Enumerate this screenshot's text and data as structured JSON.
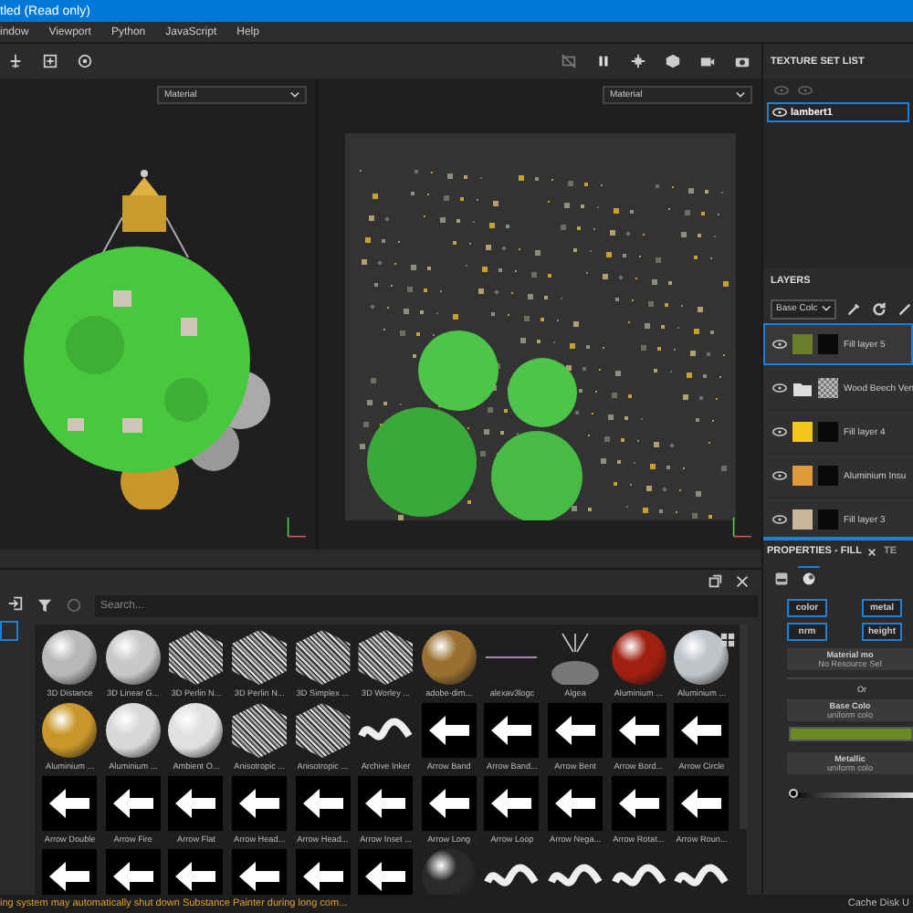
{
  "window": {
    "title": "tled (Read only)"
  },
  "menu": [
    "indow",
    "Viewport",
    "Python",
    "JavaScript",
    "Help"
  ],
  "viewports": [
    {
      "mode": "Material",
      "kind": "model"
    },
    {
      "mode": "Material",
      "kind": "uv"
    }
  ],
  "texture_set_list": {
    "title": "TEXTURE SET LIST",
    "items": [
      {
        "name": "lambert1",
        "selected": true
      }
    ]
  },
  "layers": {
    "title": "LAYERS",
    "channel": "Base Colc",
    "items": [
      {
        "name": "Fill layer 5",
        "kind": "fill",
        "color": "#6b7f2a",
        "selected": true
      },
      {
        "name": "Wood Beech Ven",
        "kind": "folder",
        "selected": false
      },
      {
        "name": "Fill layer 4",
        "kind": "fill",
        "color": "#f5c518",
        "selected": false
      },
      {
        "name": "Aluminium Insu",
        "kind": "fill",
        "color": "#e09a3a",
        "selected": false
      },
      {
        "name": "Fill layer 3",
        "kind": "fill",
        "color": "#c8b89a",
        "selected": false
      }
    ]
  },
  "shelf": {
    "search": {
      "placeholder": "Search..."
    },
    "items": [
      {
        "label": "3D Distance",
        "kind": "sphere",
        "color": "#b8b8b8"
      },
      {
        "label": "3D Linear G...",
        "kind": "sphere",
        "color": "#c8c8c8"
      },
      {
        "label": "3D Perlin N...",
        "kind": "noise"
      },
      {
        "label": "3D Perlin N...",
        "kind": "noise"
      },
      {
        "label": "3D Simplex ...",
        "kind": "noise"
      },
      {
        "label": "3D Worley ...",
        "kind": "noise"
      },
      {
        "label": "adobe-dim...",
        "kind": "sphere",
        "color": "#9a7030"
      },
      {
        "label": "alexav3logc",
        "kind": "line"
      },
      {
        "label": "Algea",
        "kind": "dome"
      },
      {
        "label": "Aluminium ...",
        "kind": "sphere",
        "color": "#a02010"
      },
      {
        "label": "Aluminium ...",
        "kind": "sphere",
        "color": "#c0c4c8"
      },
      {
        "label": "Aluminium ...",
        "kind": "sphere",
        "color": "#c8962a"
      },
      {
        "label": "Aluminium ...",
        "kind": "sphere",
        "color": "#d8d8d8"
      },
      {
        "label": "Ambient O...",
        "kind": "sphere",
        "color": "#e0e0e0"
      },
      {
        "label": "Anisotropic ...",
        "kind": "noise"
      },
      {
        "label": "Anisotropic ...",
        "kind": "noise"
      },
      {
        "label": "Archive Inker",
        "kind": "stroke"
      },
      {
        "label": "Arrow Band",
        "kind": "arrow"
      },
      {
        "label": "Arrow Band...",
        "kind": "arrow"
      },
      {
        "label": "Arrow Bent",
        "kind": "arrow"
      },
      {
        "label": "Arrow Bord...",
        "kind": "arrow"
      },
      {
        "label": "Arrow Circle",
        "kind": "arrow"
      },
      {
        "label": "Arrow Double",
        "kind": "arrow"
      },
      {
        "label": "Arrow Fire",
        "kind": "arrow"
      },
      {
        "label": "Arrow Flat",
        "kind": "arrow"
      },
      {
        "label": "Arrow Head...",
        "kind": "arrow"
      },
      {
        "label": "Arrow Head...",
        "kind": "arrow"
      },
      {
        "label": "Arrow Inset ...",
        "kind": "arrow"
      },
      {
        "label": "Arrow Long",
        "kind": "arrow"
      },
      {
        "label": "Arrow Loop",
        "kind": "arrow"
      },
      {
        "label": "Arrow Nega...",
        "kind": "arrow"
      },
      {
        "label": "Arrow Rotat...",
        "kind": "arrow"
      },
      {
        "label": "Arrow Roun...",
        "kind": "arrow"
      },
      {
        "kind": "arrow"
      },
      {
        "kind": "arrow"
      },
      {
        "kind": "arrow"
      },
      {
        "kind": "arrow"
      },
      {
        "kind": "arrow"
      },
      {
        "kind": "arrow"
      },
      {
        "kind": "sphere",
        "color": "#2a2a2a"
      },
      {
        "kind": "stroke"
      },
      {
        "kind": "stroke"
      },
      {
        "kind": "stroke"
      },
      {
        "kind": "stroke"
      }
    ]
  },
  "properties": {
    "tabs": [
      {
        "label": "PROPERTIES - FILL",
        "selected": true,
        "closable": true
      },
      {
        "label": "TE",
        "selected": false,
        "closable": false
      }
    ],
    "icon_tabs": [
      {
        "kind": "material",
        "selected": false
      },
      {
        "kind": "sphere",
        "selected": true
      }
    ],
    "channels": [
      {
        "label": "color",
        "selected": true
      },
      {
        "label": "metal",
        "selected": true
      },
      {
        "label": "nrm",
        "selected": true
      },
      {
        "label": "height",
        "selected": true
      }
    ],
    "material": {
      "title": "Material mo",
      "value": "No Resource Sel"
    },
    "separator": "Or",
    "base_color": {
      "title": "Base Colo",
      "value": "uniform colo",
      "color": "#6b8a24"
    },
    "metallic": {
      "title": "Metallic",
      "value": "uniform colo",
      "level": 0
    }
  },
  "status_bar": {
    "message": "ing system may automatically shut down Substance Painter during long com...",
    "cache": "Cache Disk U"
  }
}
